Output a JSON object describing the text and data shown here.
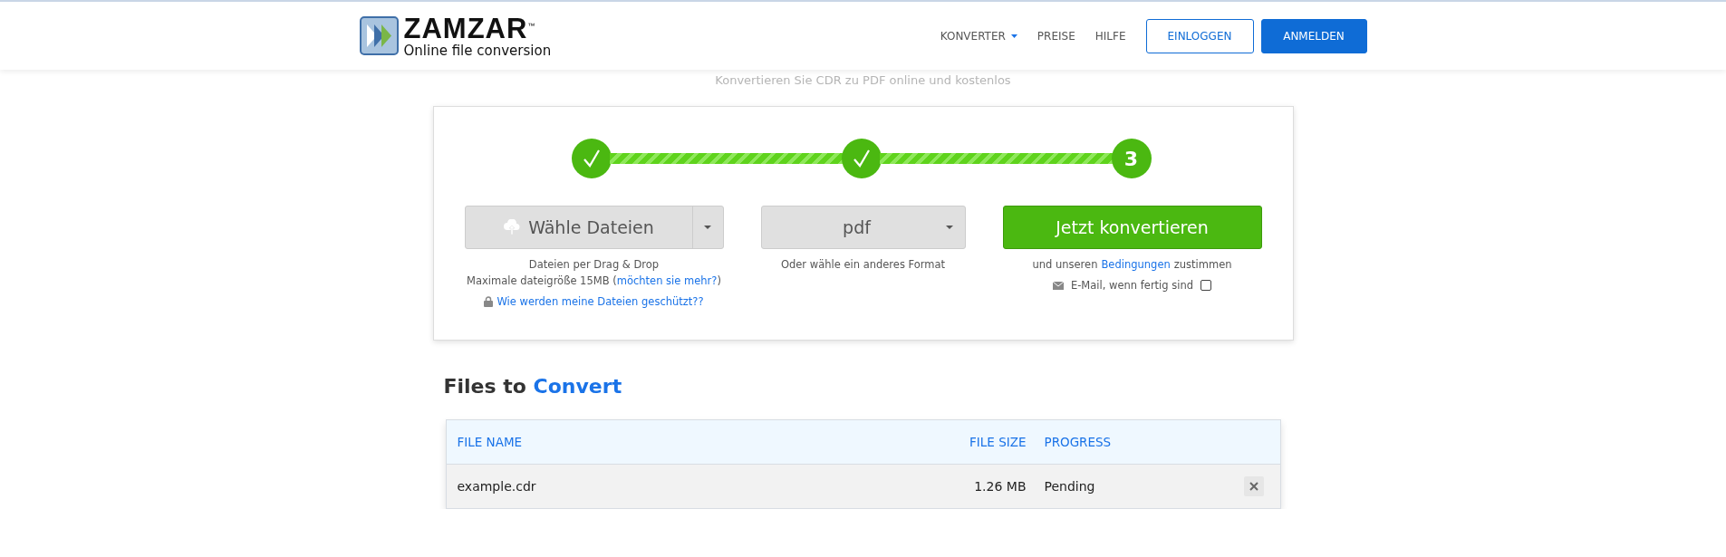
{
  "header": {
    "logo": {
      "name": "ZAMZAR",
      "trademark": "™",
      "tagline": "Online file conversion"
    },
    "nav": [
      {
        "label": "KONVERTER",
        "kind": "dropdown"
      },
      {
        "label": "PREISE",
        "kind": "link"
      },
      {
        "label": "HILFE",
        "kind": "link"
      }
    ],
    "buttons": [
      {
        "label": "EINLOGGEN",
        "kind": "outline"
      },
      {
        "label": "ANMELDEN",
        "kind": "primary"
      }
    ]
  },
  "subtitle": "Konvertieren Sie CDR zu PDF online und kostenlos",
  "steps": [
    {
      "kind": "done"
    },
    {
      "kind": "done",
      "level": 1
    },
    {
      "kind": "number",
      "label": "3",
      "level": 1
    }
  ],
  "upload": {
    "button": "Wähle Dateien",
    "hint": "Dateien per Drag & Drop",
    "size_text": "Maximale dateigröße 15MB (",
    "size_link": "möchten sie mehr?",
    "size_end": ")",
    "security_link": "Wie werden meine Dateien geschützt??"
  },
  "format": {
    "value": "pdf",
    "hint": "Oder wähle ein anderes Format"
  },
  "convert": {
    "button": "Jetzt konvertieren",
    "terms_before": "und unseren",
    "terms_link": "Bedingungen",
    "terms_after": "zustimmen",
    "email_label": "E-Mail, wenn fertig sind",
    "email_checked": false
  },
  "files": {
    "title_start": "Files to",
    "title_accent": "Convert",
    "columns": [
      "FILE NAME",
      "FILE SIZE",
      "PROGRESS"
    ],
    "rows": [
      {
        "name": "example.cdr",
        "size": "1.26 MB",
        "progress": "Pending"
      }
    ]
  }
}
